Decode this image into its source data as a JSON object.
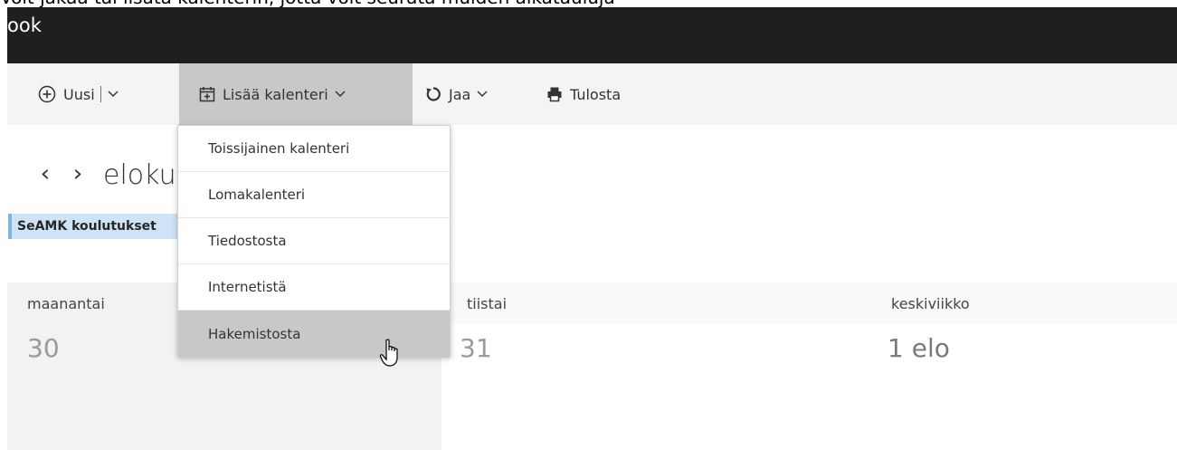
{
  "top_strip": {
    "text": "Voit jakaa tai lisätä kalenterin, jotta voit seurata muiden aikatauluja"
  },
  "titlebar": {
    "app_name": "ook"
  },
  "toolbar": {
    "new_label": "Uusi",
    "add_calendar_label": "Lisää kalenteri",
    "share_label": "Jaa",
    "print_label": "Tulosta",
    "icons": {
      "new": "plus-circle-icon",
      "add_calendar": "calendar-add-icon",
      "share": "share-icon",
      "print": "printer-icon",
      "chevron": "chevron-down-icon"
    }
  },
  "add_calendar_menu": {
    "items": [
      {
        "label": "Toissijainen kalenteri"
      },
      {
        "label": "Lomakalenteri"
      },
      {
        "label": "Tiedostosta"
      },
      {
        "label": "Internetistä"
      },
      {
        "label": "Hakemistosta",
        "hovered": true
      }
    ]
  },
  "navigation": {
    "prev": "‹",
    "next": "›",
    "month_title": "elokuu 2017"
  },
  "calendar_chip": {
    "label": "SeAMK koulutukset",
    "color": "#7ab3e6"
  },
  "days": [
    {
      "name": "maanantai",
      "date": "30"
    },
    {
      "name": "tiistai",
      "date": "31"
    },
    {
      "name": "keskiviikko",
      "date": "1 elo"
    }
  ]
}
